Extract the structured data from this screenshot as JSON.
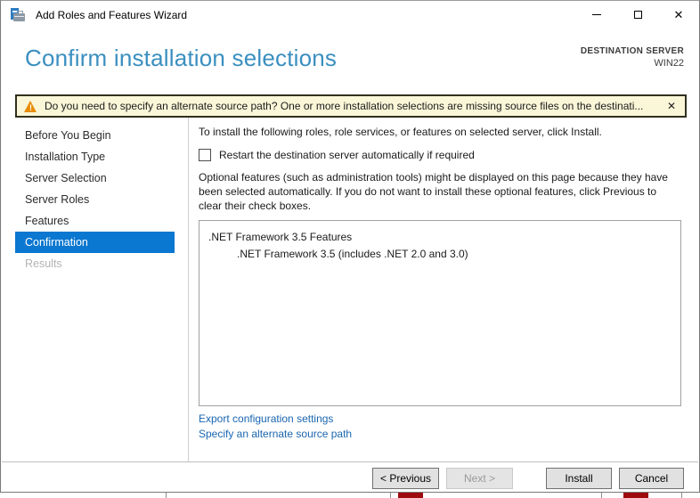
{
  "window": {
    "title": "Add Roles and Features Wizard",
    "controls": {
      "minimize": "minimize",
      "maximize": "maximize",
      "close": "close"
    }
  },
  "header": {
    "title": "Confirm installation selections",
    "destination_label": "DESTINATION SERVER",
    "server_name": "WIN22"
  },
  "warning_banner": {
    "message": "Do you need to specify an alternate source path? One or more installation selections are missing source files on the destinati...",
    "close_glyph": "✕",
    "exclamation": "!"
  },
  "sidebar": {
    "items": [
      {
        "label": "Before You Begin",
        "state": "normal"
      },
      {
        "label": "Installation Type",
        "state": "normal"
      },
      {
        "label": "Server Selection",
        "state": "normal"
      },
      {
        "label": "Server Roles",
        "state": "normal"
      },
      {
        "label": "Features",
        "state": "normal"
      },
      {
        "label": "Confirmation",
        "state": "current"
      },
      {
        "label": "Results",
        "state": "disabled"
      }
    ]
  },
  "main": {
    "instruction": "To install the following roles, role services, or features on selected server, click Install.",
    "restart_checkbox": {
      "label": "Restart the destination server automatically if required",
      "checked": false
    },
    "optional_note": "Optional features (such as administration tools) might be displayed on this page because they have been selected automatically. If you do not want to install these optional features, click Previous to clear their check boxes.",
    "selection_tree": [
      {
        "label": ".NET Framework 3.5 Features",
        "level": 0
      },
      {
        "label": ".NET Framework 3.5 (includes .NET 2.0 and 3.0)",
        "level": 1
      }
    ],
    "links": [
      {
        "label": "Export configuration settings"
      },
      {
        "label": "Specify an alternate source path"
      }
    ]
  },
  "footer": {
    "buttons": [
      {
        "label": "< Previous",
        "enabled": true
      },
      {
        "label": "Next >",
        "enabled": false
      },
      {
        "label": "Install",
        "enabled": true
      },
      {
        "label": "Cancel",
        "enabled": true
      }
    ]
  },
  "colors": {
    "accent_blue": "#0a77d0",
    "heading_blue": "#3a8fc0",
    "link_blue": "#1a66b0",
    "warning_bg": "#faf6d8",
    "warning_border": "#31301e",
    "warning_icon": "#e78c07",
    "status_red": "#9e0b0f"
  }
}
